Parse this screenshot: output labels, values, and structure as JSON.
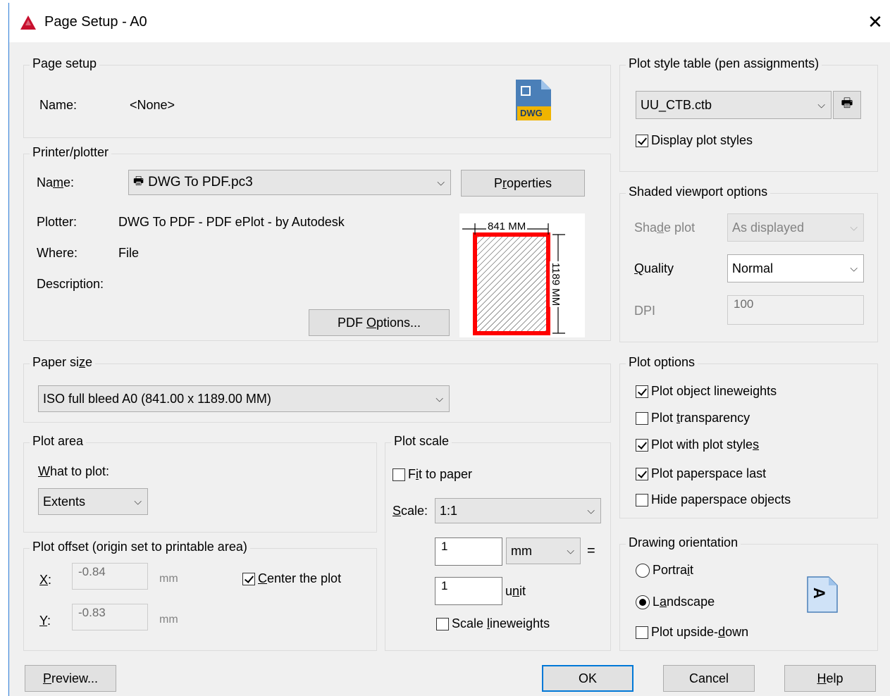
{
  "window": {
    "title": "Page Setup - A0",
    "close_label": "✕"
  },
  "page_setup": {
    "group_label": "Page setup",
    "name_label": "Name:",
    "name_value": "<None>",
    "dwg_icon_text": "DWG"
  },
  "printer": {
    "group_label": "Printer/plotter",
    "name_label": "Name:",
    "name_value": "DWG To PDF.pc3",
    "properties_button": "Properties",
    "plotter_label": "Plotter:",
    "plotter_value": "DWG To PDF - PDF ePlot - by Autodesk",
    "where_label": "Where:",
    "where_value": "File",
    "description_label": "Description:",
    "pdf_options_button": "PDF Options...",
    "preview_width_label": "841 MM",
    "preview_height_label": "1189 MM"
  },
  "paper_size": {
    "group_label": "Paper size",
    "value": "ISO full bleed A0 (841.00 x 1189.00 MM)"
  },
  "plot_area": {
    "group_label": "Plot area",
    "what_label": "What to plot:",
    "what_value": "Extents"
  },
  "plot_offset": {
    "group_label": "Plot offset (origin set to printable area)",
    "x_label": "X:",
    "x_value": "-0.84",
    "x_unit": "mm",
    "y_label": "Y:",
    "y_value": "-0.83",
    "y_unit": "mm",
    "center_label": "Center the plot",
    "center_checked": true
  },
  "plot_scale": {
    "group_label": "Plot scale",
    "fit_label": "Fit to paper",
    "fit_checked": false,
    "scale_label": "Scale:",
    "scale_value": "1:1",
    "value1": "1",
    "unit1": "mm",
    "equals": "=",
    "value2": "1",
    "unit2": "unit",
    "lineweights_label": "Scale lineweights",
    "lineweights_checked": false
  },
  "plot_style_table": {
    "group_label": "Plot style table (pen assignments)",
    "value": "UU_CTB.ctb",
    "display_label": "Display plot styles",
    "display_checked": true
  },
  "shaded_viewport": {
    "group_label": "Shaded viewport options",
    "shade_label": "Shade plot",
    "shade_value": "As displayed",
    "quality_label": "Quality",
    "quality_value": "Normal",
    "dpi_label": "DPI",
    "dpi_value": "100"
  },
  "plot_options": {
    "group_label": "Plot options",
    "items": [
      {
        "label": "Plot object lineweights",
        "checked": true
      },
      {
        "label": "Plot transparency",
        "checked": false
      },
      {
        "label": "Plot with plot styles",
        "checked": true
      },
      {
        "label": "Plot paperspace last",
        "checked": true
      },
      {
        "label": "Hide paperspace objects",
        "checked": false
      }
    ]
  },
  "orientation": {
    "group_label": "Drawing orientation",
    "portrait_label": "Portrait",
    "landscape_label": "Landscape",
    "upside_label": "Plot upside-down",
    "selected": "Landscape",
    "icon_letter": "A"
  },
  "buttons": {
    "preview": "Preview...",
    "ok": "OK",
    "cancel": "Cancel",
    "help": "Help"
  },
  "colors": {
    "accent": "#0078d7",
    "preview_frame": "#ff0000",
    "group_border": "#dcdcdc"
  }
}
